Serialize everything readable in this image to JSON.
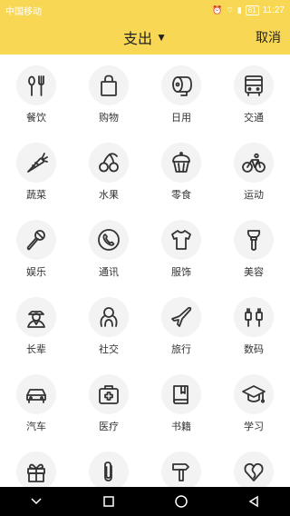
{
  "status": {
    "carrier": "中国移动",
    "battery": "61",
    "time": "11:27"
  },
  "header": {
    "title": "支出",
    "cancel": "取消"
  },
  "categories": [
    {
      "label": "餐饮",
      "icon": "fork-spoon-icon"
    },
    {
      "label": "购物",
      "icon": "shopping-bag-icon"
    },
    {
      "label": "日用",
      "icon": "tissue-roll-icon"
    },
    {
      "label": "交通",
      "icon": "bus-icon"
    },
    {
      "label": "蔬菜",
      "icon": "carrot-icon"
    },
    {
      "label": "水果",
      "icon": "cherry-icon"
    },
    {
      "label": "零食",
      "icon": "cupcake-icon"
    },
    {
      "label": "运动",
      "icon": "bicycle-icon"
    },
    {
      "label": "娱乐",
      "icon": "microphone-icon"
    },
    {
      "label": "通讯",
      "icon": "phone-icon"
    },
    {
      "label": "服饰",
      "icon": "tshirt-icon"
    },
    {
      "label": "美容",
      "icon": "makeup-brush-icon"
    },
    {
      "label": "长辈",
      "icon": "elder-icon"
    },
    {
      "label": "社交",
      "icon": "social-icon"
    },
    {
      "label": "旅行",
      "icon": "airplane-icon"
    },
    {
      "label": "数码",
      "icon": "plug-icon"
    },
    {
      "label": "汽车",
      "icon": "car-icon"
    },
    {
      "label": "医疗",
      "icon": "medical-kit-icon"
    },
    {
      "label": "书籍",
      "icon": "book-icon"
    },
    {
      "label": "学习",
      "icon": "graduation-cap-icon"
    },
    {
      "label": "",
      "icon": "gift-icon"
    },
    {
      "label": "",
      "icon": "paperclip-icon"
    },
    {
      "label": "",
      "icon": "hammer-icon"
    },
    {
      "label": "",
      "icon": "heart-icon"
    }
  ]
}
